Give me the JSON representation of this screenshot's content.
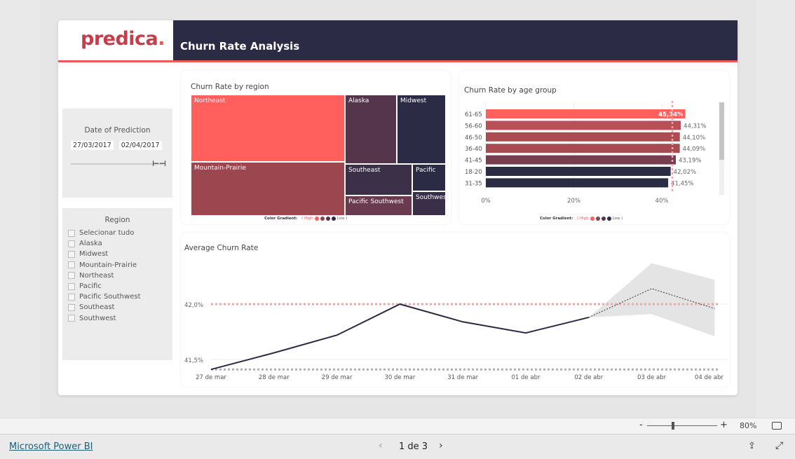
{
  "header": {
    "logo": "predica",
    "logo_dot": ".",
    "title": "Churn Rate Analysis"
  },
  "date_filter": {
    "label": "Date of Prediction",
    "start": "27/03/2017",
    "end": "02/04/2017"
  },
  "region_filter": {
    "label": "Region",
    "items": [
      "Selecionar tudo",
      "Alaska",
      "Midwest",
      "Mountain-Prairie",
      "Northeast",
      "Pacific",
      "Pacific Southwest",
      "Southeast",
      "Southwest"
    ]
  },
  "legend": {
    "label": "Color Gradient:",
    "high": "( High",
    "low": "Low )"
  },
  "colors": {
    "high": "#ff5f5d",
    "mid_high": "#a3464f",
    "mid_low": "#6f3a4f",
    "low": "#2b2b45"
  },
  "chart_data": [
    {
      "type": "treemap",
      "title": "Churn Rate by region",
      "items": [
        {
          "label": "Northeast",
          "color": "#ff5f5d"
        },
        {
          "label": "Mountain-Prairie",
          "color": "#9c4650"
        },
        {
          "label": "Alaska",
          "color": "#55354b"
        },
        {
          "label": "Midwest",
          "color": "#2b2b45"
        },
        {
          "label": "Southeast",
          "color": "#3c2f48"
        },
        {
          "label": "Pacific",
          "color": "#2b2b45"
        },
        {
          "label": "Pacific Southwest",
          "color": "#6a3a4e"
        },
        {
          "label": "Southwest",
          "color": "#3a2f48"
        }
      ]
    },
    {
      "type": "bar",
      "title": "Churn Rate by age group",
      "orientation": "horizontal",
      "categories": [
        "61-65",
        "56-60",
        "46-50",
        "36-40",
        "41-45",
        "18-20",
        "31-35"
      ],
      "values": [
        45.34,
        44.31,
        44.1,
        44.09,
        43.19,
        42.02,
        41.45
      ],
      "labels": [
        "45,34%",
        "44,31%",
        "44,10%",
        "44,09%",
        "43,19%",
        "42,02%",
        "41,45%"
      ],
      "colors": [
        "#ff5f5d",
        "#b85056",
        "#ad4b53",
        "#a84a52",
        "#773e50",
        "#2b2b45",
        "#2b2b45"
      ],
      "xticks": [
        "0%",
        "20%",
        "40%"
      ],
      "xlim": [
        0,
        48
      ],
      "reference_line": 42.4
    },
    {
      "type": "line",
      "title": "Average Churn Rate",
      "categories": [
        "27 de mar",
        "28 de mar",
        "29 de mar",
        "30 de mar",
        "31 de mar",
        "01 de abr",
        "02 de abr",
        "03 de abr",
        "04 de abr"
      ],
      "values": [
        41.41,
        41.56,
        41.72,
        42.0,
        41.84,
        41.74,
        41.88,
        null,
        null
      ],
      "forecast": [
        null,
        null,
        null,
        null,
        null,
        null,
        41.88,
        42.14,
        41.96
      ],
      "forecast_upper": [
        null,
        null,
        null,
        null,
        null,
        null,
        41.88,
        42.37,
        42.22
      ],
      "forecast_lower": [
        null,
        null,
        null,
        null,
        null,
        null,
        41.88,
        41.91,
        41.71
      ],
      "yticks": [
        "41,5%",
        "42,0%"
      ],
      "ytick_values": [
        41.5,
        42.0
      ],
      "ylim": [
        41.38,
        42.4
      ],
      "reference_lines": [
        {
          "value": 42.0,
          "color": "#f7a3a6"
        },
        {
          "value": 41.41,
          "color": "#b0b0b0"
        }
      ]
    }
  ],
  "zoom": {
    "minus": "-",
    "plus": "+",
    "level": "80%",
    "level_fraction": 0.5
  },
  "footer": {
    "brand": "Microsoft Power BI",
    "page": "1 de 3"
  }
}
